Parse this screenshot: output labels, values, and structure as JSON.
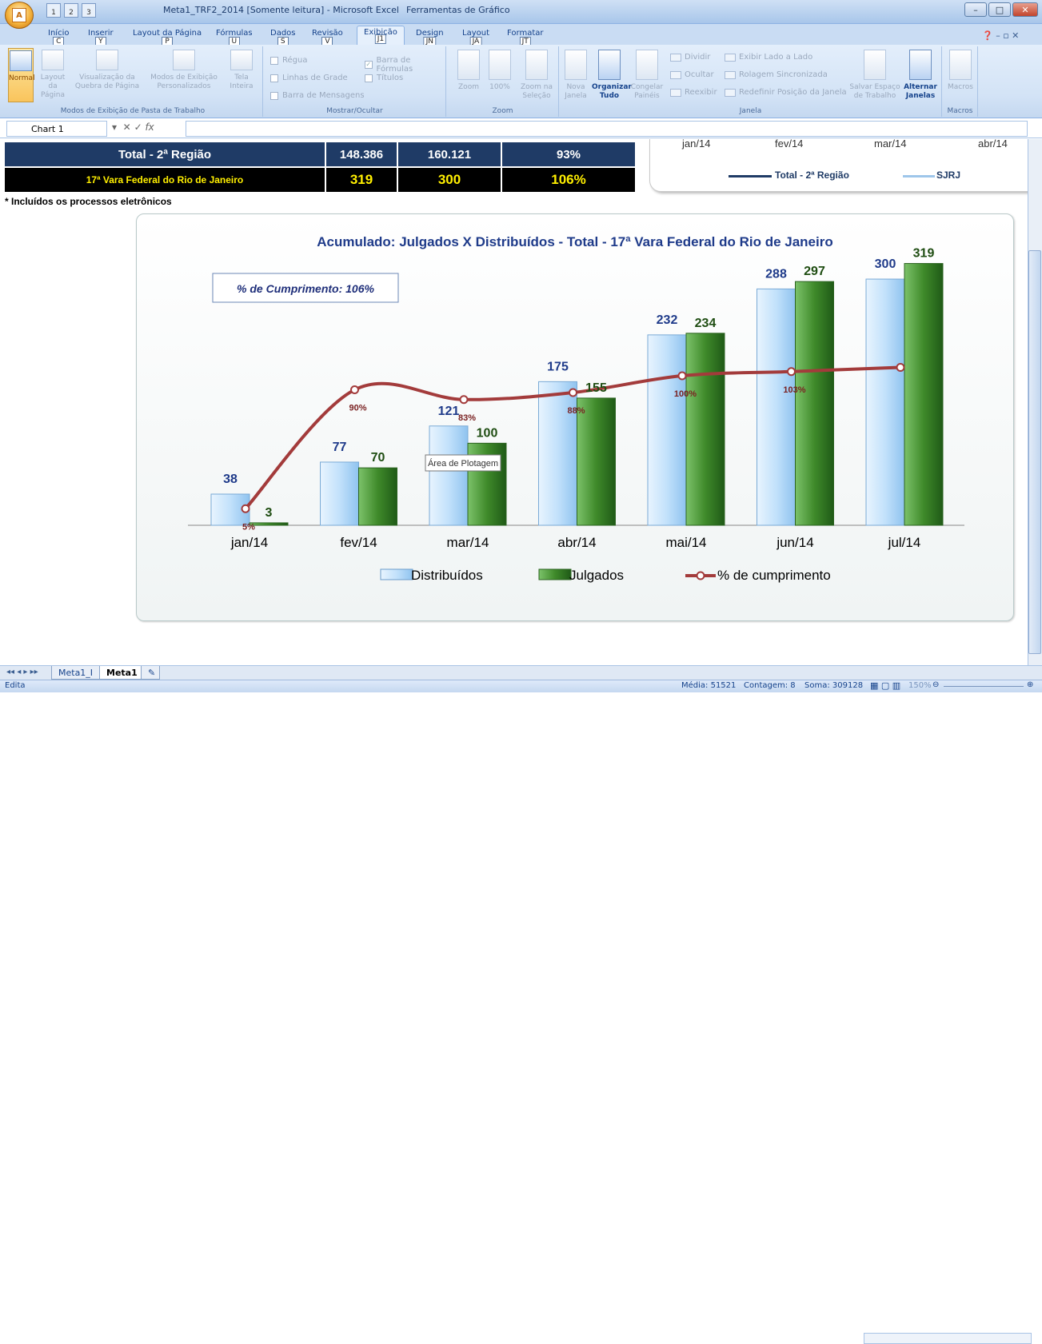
{
  "window": {
    "title": "Meta1_TRF2_2014  [Somente leitura] - Microsoft Excel",
    "tool_context": "Ferramentas de Gráfico",
    "office_key": "A",
    "qat_keys": [
      "1",
      "2",
      "3"
    ]
  },
  "tabs": [
    {
      "label": "Início",
      "key": "C"
    },
    {
      "label": "Inserir",
      "key": "Y"
    },
    {
      "label": "Layout da Página",
      "key": "P"
    },
    {
      "label": "Fórmulas",
      "key": "U"
    },
    {
      "label": "Dados",
      "key": "S"
    },
    {
      "label": "Revisão",
      "key": "V"
    },
    {
      "label": "Exibição",
      "key": "J1"
    },
    {
      "label": "Design",
      "key": "JN"
    },
    {
      "label": "Layout",
      "key": "JA"
    },
    {
      "label": "Formatar",
      "key": "JT"
    }
  ],
  "ribbon": {
    "group1": {
      "label": "Modos de Exibição de Pasta de Trabalho",
      "buttons": [
        "Normal",
        "Layout da Página",
        "Visualização da Quebra de Página",
        "Modos de Exibição Personalizados",
        "Tela Inteira"
      ]
    },
    "group2": {
      "label": "Mostrar/Ocultar",
      "checks": [
        "Régua",
        "Linhas de Grade",
        "Barra de Mensagens",
        "Barra de Fórmulas",
        "Títulos"
      ]
    },
    "group3": {
      "label": "Zoom",
      "buttons": [
        "Zoom",
        "100%",
        "Zoom na Seleção"
      ]
    },
    "group4": {
      "label": "Janela",
      "buttons": [
        "Nova Janela",
        "Organizar Tudo",
        "Congelar Painéis"
      ],
      "small": [
        "Dividir",
        "Ocultar",
        "Reexibir",
        "Exibir Lado a Lado",
        "Rolagem Sincronizada",
        "Redefinir Posição da Janela"
      ],
      "buttons2": [
        "Salvar Espaço de Trabalho",
        "Alternar Janelas"
      ]
    },
    "group5": {
      "label": "Macros",
      "buttons": [
        "Macros"
      ]
    }
  },
  "formula_bar": {
    "name_box": "Chart 1",
    "fx": "fx",
    "value": ""
  },
  "table": {
    "row1": {
      "label": "Total - 2ª Região",
      "v1": "148.386",
      "v2": "160.121",
      "v3": "93%"
    },
    "row2": {
      "label": "17ª Vara Federal do Rio de Janeiro",
      "v1": "319",
      "v2": "300",
      "v3": "106%"
    }
  },
  "footnote": "* Incluídos os processos eletrônicos",
  "mini_chart": {
    "ticks": [
      "jan/14",
      "fev/14",
      "mar/14",
      "abr/14"
    ],
    "legend": [
      "Total - 2ª Região",
      "SJRJ"
    ]
  },
  "chart_data": {
    "type": "bar",
    "title": "Acumulado: Julgados X Distribuídos  -  Total   -  17ª Vara Federal do Rio de Janeiro",
    "annotation": "% de Cumprimento: 106%",
    "categories": [
      "jan/14",
      "fev/14",
      "mar/14",
      "abr/14",
      "mai/14",
      "jun/14",
      "jul/14"
    ],
    "series": [
      {
        "name": "Distribuídos",
        "values": [
          38,
          77,
          121,
          175,
          232,
          288,
          300
        ],
        "color": "#bfe0fa"
      },
      {
        "name": "Julgados",
        "values": [
          3,
          70,
          100,
          155,
          234,
          297,
          319
        ],
        "color": "#3f8a2a"
      },
      {
        "name": "% de cumprimento",
        "type": "line",
        "values": [
          5,
          90,
          83,
          88,
          100,
          103,
          106
        ],
        "labels": [
          "5%",
          "90%",
          "83%",
          "88%",
          "100%",
          "103%",
          ""
        ],
        "color": "#a33b3b"
      }
    ],
    "ylim": [
      0,
      340
    ],
    "tooltip": "Área de Plotagem"
  },
  "sheet_tabs": [
    "Meta1_I",
    "Meta1"
  ],
  "status": {
    "mode": "Edita",
    "average": "Média: 51521",
    "count": "Contagem: 8",
    "sum": "Soma: 309128",
    "zoom": "150%"
  }
}
